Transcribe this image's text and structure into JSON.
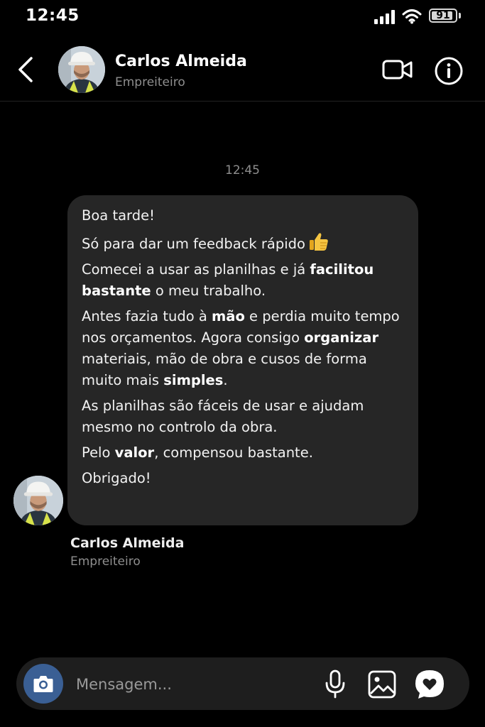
{
  "status_bar": {
    "time": "12:45",
    "battery_level": "91",
    "battery_fraction": 0.91,
    "icons": [
      "signal-icon",
      "wifi-icon",
      "battery-icon"
    ]
  },
  "header": {
    "contact_name": "Carlos Almeida",
    "contact_role": "Empreiteiro",
    "icons": [
      "back-icon",
      "video-camera-icon",
      "info-icon"
    ]
  },
  "chat": {
    "timestamp": "12:45",
    "message": {
      "line_greeting": "Boa tarde!",
      "line_feedback": "Só para dar um feedback rápido",
      "p2_a": "Comecei a usar as planilhas e já ",
      "p2_b": "facilitou bastante",
      "p2_c": " o meu trabalho.",
      "p3_a": "Antes fazia tudo à ",
      "p3_b": "mão",
      "p3_c": " e perdia muito tempo nos orçamentos. Agora consigo ",
      "p3_d": "organizar",
      "p3_e": " materiais, mão de obra e cusos de forma muito mais ",
      "p3_f": "simples",
      "p3_g": ".",
      "p4": "As planilhas são fáceis de usar e ajudam mesmo no controlo da obra.",
      "p5_a": "Pelo ",
      "p5_b": "valor",
      "p5_c": ", compensou bastante.",
      "p6": "Obrigado!"
    },
    "sender": {
      "name": "Carlos Almeida",
      "role": "Empreiteiro"
    }
  },
  "composer": {
    "placeholder": "Mensagem...",
    "icons": [
      "camera-icon",
      "microphone-icon",
      "image-icon",
      "heart-icon"
    ]
  },
  "colors": {
    "background": "#000000",
    "bubble": "#262626",
    "composer": "#1e1e1e",
    "camera_accent": "#3a5f94",
    "muted_text": "#8e8e8e"
  }
}
